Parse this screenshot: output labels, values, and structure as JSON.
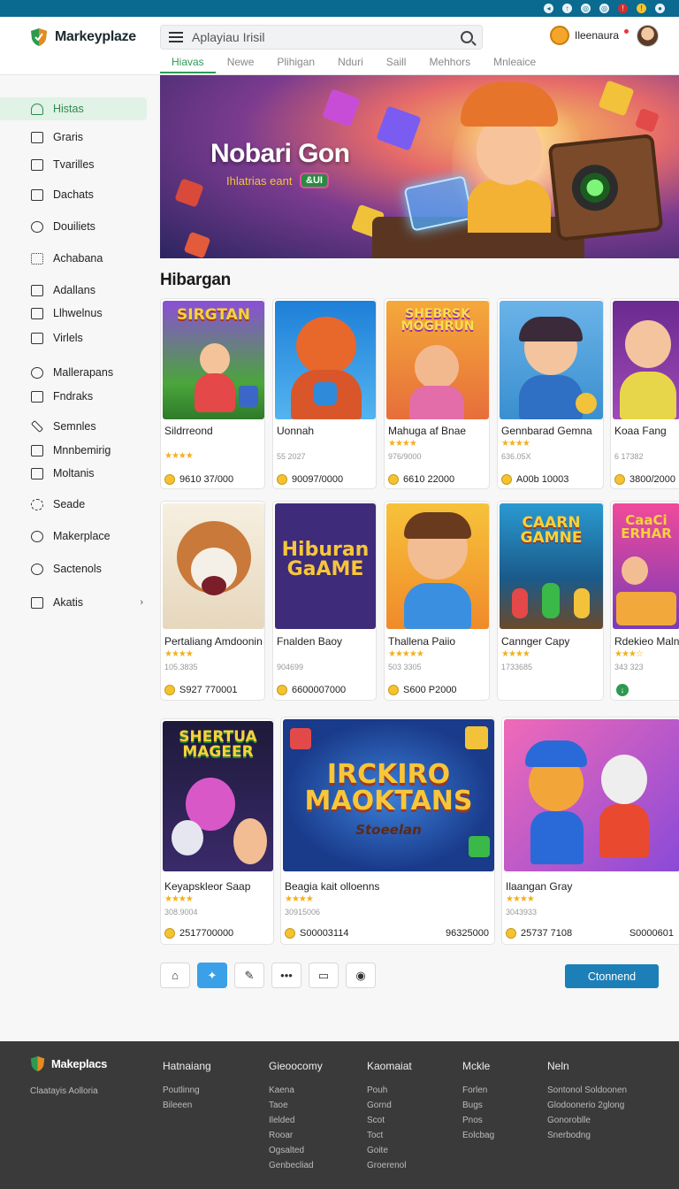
{
  "app": {
    "name": "Markeyplaze"
  },
  "header": {
    "search_value": "Aplayiau Irisil",
    "user_name": "Ileenaura",
    "tabs": [
      {
        "label": "Hiavas"
      },
      {
        "label": "Newe"
      },
      {
        "label": "Plihigan"
      },
      {
        "label": "Nduri"
      },
      {
        "label": "Saill"
      },
      {
        "label": "Mehhors"
      },
      {
        "label": "Mnleaice"
      }
    ]
  },
  "sidebar": {
    "items": [
      {
        "label": "Histas",
        "icon": "home-icon"
      },
      {
        "label": "Graris",
        "icon": "grid-icon"
      },
      {
        "label": "Tvarilles",
        "icon": "window-icon"
      },
      {
        "label": "Dachats",
        "icon": "box-icon"
      },
      {
        "label": "Douiliets",
        "icon": "sun-icon"
      },
      {
        "label": "Achabana",
        "icon": "list-icon"
      },
      {
        "label": "Adallans",
        "icon": "house-icon"
      },
      {
        "label": "Llhwelnus",
        "icon": "tag-icon"
      },
      {
        "label": "Virlels",
        "icon": "video-icon"
      },
      {
        "label": "Mallerapans",
        "icon": "badge-icon"
      },
      {
        "label": "Fndraks",
        "icon": "gift-icon"
      },
      {
        "label": "Semnles",
        "icon": "pen-icon"
      },
      {
        "label": "Mnnbemirig",
        "icon": "play-icon"
      },
      {
        "label": "Moltanis",
        "icon": "bag-icon"
      },
      {
        "label": "Seade",
        "icon": "settings-icon"
      },
      {
        "label": "Makerplace",
        "icon": "market-icon"
      },
      {
        "label": "Sactenols",
        "icon": "search-icon"
      },
      {
        "label": "Akatis",
        "icon": "folder-icon"
      }
    ]
  },
  "hero": {
    "title": "Nobari Gon",
    "subtitle": "Ihlatrias eant",
    "badge": "&UI"
  },
  "section": {
    "title": "Hibargan"
  },
  "cards_row1": [
    {
      "art": "SIRGTAN",
      "name": "Sildrreond",
      "stars": "★★★★",
      "meta": "",
      "price": "9610 37/000"
    },
    {
      "art": "",
      "name": "Uonnah",
      "stars": "",
      "meta": "55 2027",
      "price": "90097/0000"
    },
    {
      "art": "SHEBRSK MOGHRUN",
      "name": "Mahuga af Bnae",
      "stars": "★★★★",
      "meta": "976/9000",
      "price": "6610 22000"
    },
    {
      "art": "",
      "name": "Gennbarad Gemna",
      "stars": "★★★★",
      "meta": "636.05X",
      "price": "A00b 10003"
    },
    {
      "art": "",
      "name": "Koaa Fang",
      "stars": "",
      "meta": "6 17382",
      "price": "3800/2000"
    }
  ],
  "cards_row2": [
    {
      "art": "",
      "name": "Pertaliang Amdoonin",
      "stars": "★★★★",
      "meta": "105.3835",
      "price": "S927 770001"
    },
    {
      "art": "Hiburan GaAME",
      "name": "Fnalden Baoy",
      "stars": "",
      "meta": "904699",
      "price": "6600007000"
    },
    {
      "art": "",
      "name": "Thallena Paiio",
      "stars": "★★★★★",
      "meta": "503 3305",
      "price": "S600 P2000"
    },
    {
      "art": "CAARN GAMNE",
      "name": "Cannger Capy",
      "stars": "★★★★",
      "meta": "1733685",
      "price": ""
    },
    {
      "art": "CaaCi ERHAR",
      "name": "Rdekieo Maln",
      "stars": "★★★☆",
      "meta": "343 323",
      "price": ""
    }
  ],
  "cards_row3": [
    {
      "art": "SHERTUA MAGEER",
      "name": "Keyapskleor Saap",
      "stars": "★★★★",
      "meta": "308.9004",
      "price": "2517700000",
      "price2": ""
    },
    {
      "art": "IRCKIRO MAOKTANS",
      "art_sub": "Stoeelan",
      "name": "Beagia kait olloenns",
      "stars": "★★★★",
      "meta": "30915006",
      "price": "S00003114",
      "price2": "96325000"
    },
    {
      "art": "",
      "name": "Ilaangan Gray",
      "stars": "★★★★",
      "meta": "3043933",
      "price": "25737 7108",
      "price2": "S0000601"
    }
  ],
  "actions": {
    "connect_label": "Ctonnend",
    "more_label": "•••"
  },
  "footer": {
    "brand": "Makeplacs",
    "tagline": "Claatayis Aolloria",
    "columns": [
      {
        "title": "Hatnaiang",
        "links": [
          "Poutlinng",
          "Bileeen"
        ]
      },
      {
        "title": "Gieoocomy",
        "links": [
          "Kaena",
          "Taoe",
          "Ilelded",
          "Rooar",
          "Ogsalted"
        ]
      },
      {
        "title": "Kaomaiat",
        "links": [
          "Pouh",
          "Gornd",
          "Scot",
          "Toct",
          "Goite"
        ]
      },
      {
        "title": "Mckle",
        "links": [
          "Forlen",
          "Bugs",
          "Pnos",
          "Eolcbag"
        ]
      },
      {
        "title": "Neln",
        "links": [
          "Sontonol Soldoonen",
          "Glodoonerio 2glong",
          "Gonoroblle",
          "Snerbodng"
        ]
      }
    ],
    "extra_left": "Genbecliad",
    "extra_right": "Groerenol"
  },
  "colors": {
    "accent": "#2f9a59",
    "brand_blue": "#1c7fb8",
    "footer_bg": "#3a3a3a",
    "topbar": "#0b6a8f"
  }
}
